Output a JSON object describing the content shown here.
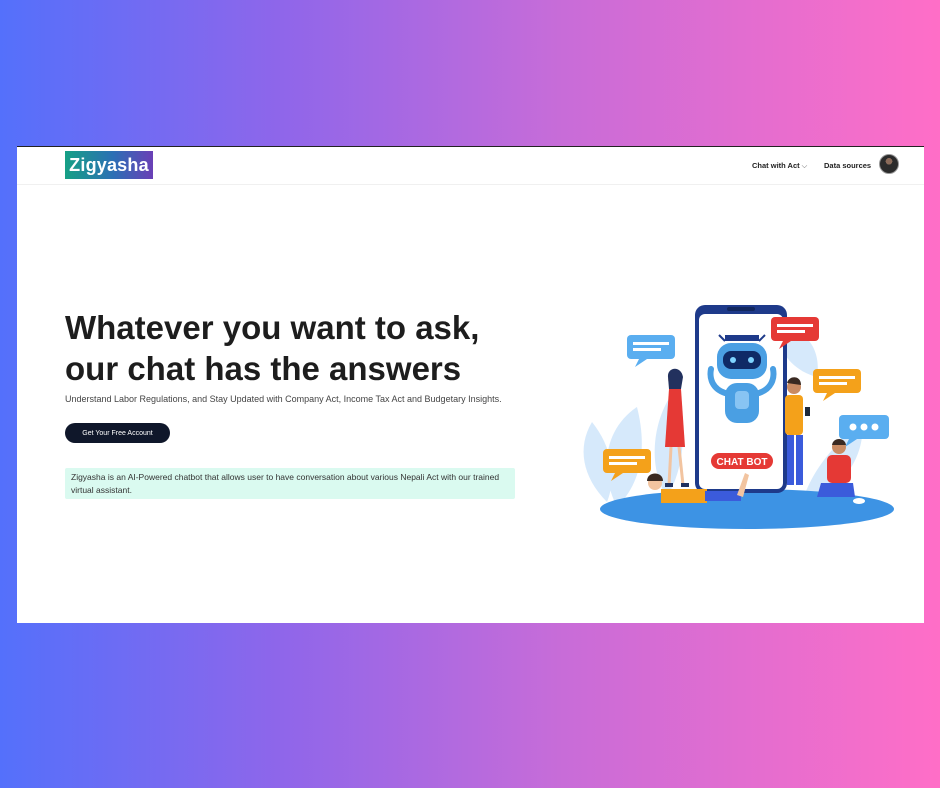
{
  "nav": {
    "logo": "Zigyasha",
    "links": [
      {
        "label": "Chat with Act",
        "chevron": "⌵"
      },
      {
        "label": "Data sources"
      }
    ],
    "avatar_icon": "user-avatar"
  },
  "hero": {
    "headline_line1": "Whatever you want to ask,",
    "headline_line2": "our chat has the answers",
    "subtitle": "Understand Labor Regulations, and Stay Updated with Company Act, Income Tax Act and Budgetary Insights.",
    "cta_label": "Get Your Free Account",
    "info_text": "Zigyasha is an AI-Powered chatbot that allows user to have conversation about various Nepali Act with our trained virtual assistant."
  },
  "illustration": {
    "badge_text": "CHAT BOT",
    "colors": {
      "phone": "#1e3a8a",
      "robot": "#4a9fe3",
      "badge": "#e53935",
      "bubble_blue": "#5aaef0",
      "bubble_orange": "#f4a11a",
      "bubble_red": "#e53935",
      "floor": "#3d93e4"
    }
  },
  "theme": {
    "background_gradient": [
      "#5470fb",
      "#ff6ec7"
    ],
    "cta_bg": "#0f172a",
    "info_bg": "#dafaf0"
  }
}
